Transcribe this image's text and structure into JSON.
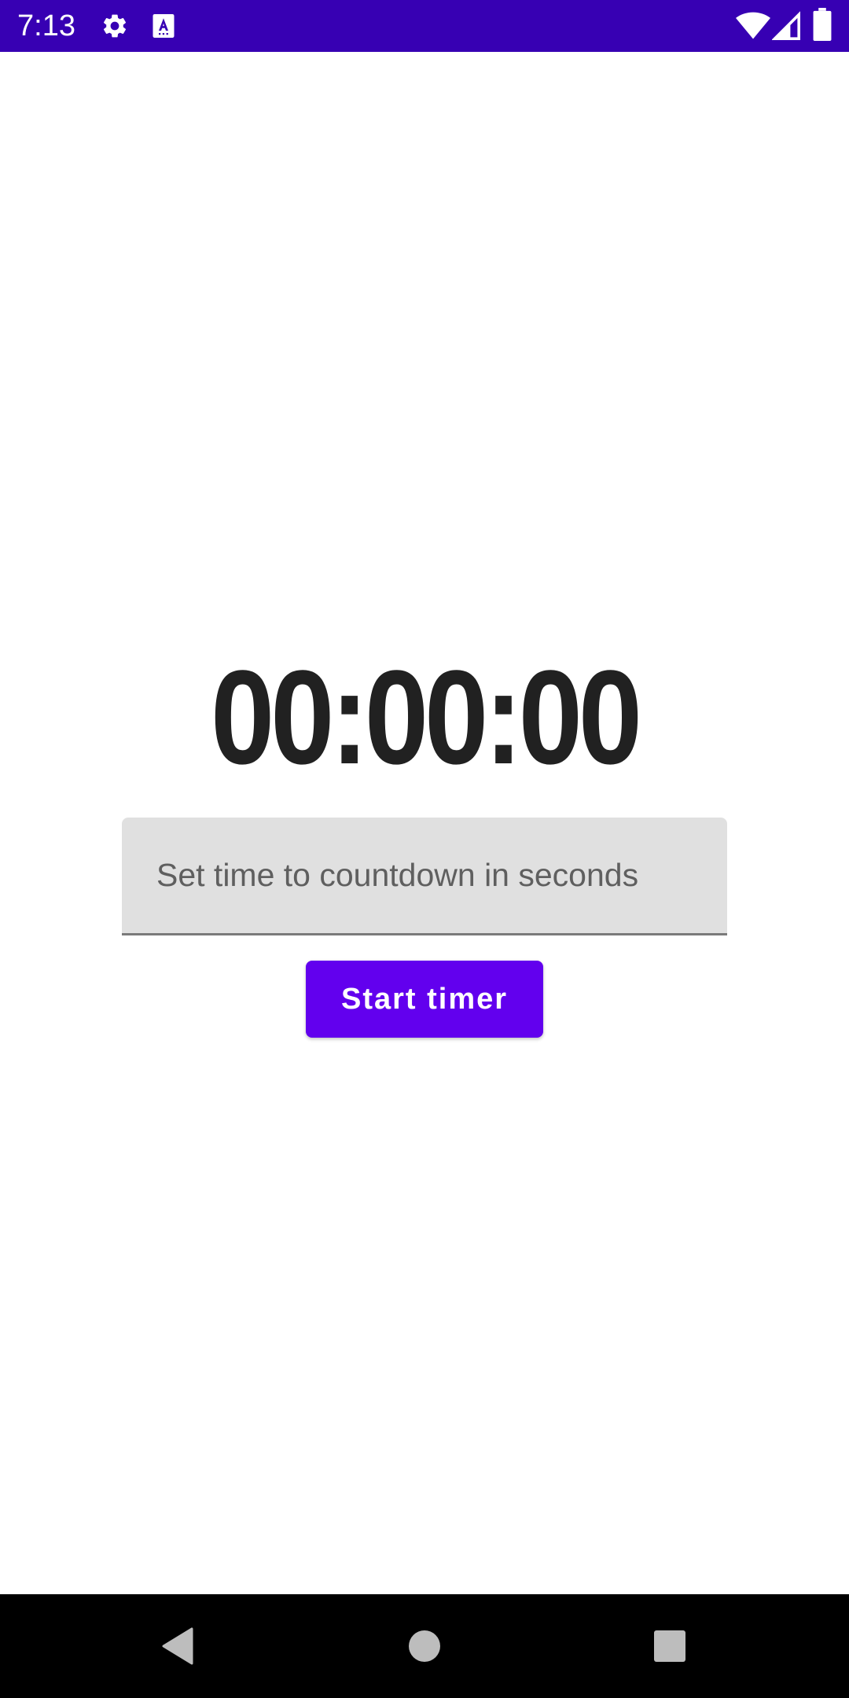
{
  "status_bar": {
    "time": "7:13",
    "icons": [
      "gear-icon",
      "a-text-icon",
      "wifi-icon",
      "signal-icon",
      "battery-icon"
    ],
    "background": "#3700b3"
  },
  "timer": {
    "display": "00:00:00"
  },
  "countdown_input": {
    "value": "",
    "placeholder": "Set time to countdown in seconds"
  },
  "start_button": {
    "label": "Start timer",
    "color": "#6200ee"
  },
  "nav_bar": {
    "buttons": [
      "back-icon",
      "home-icon",
      "recents-icon"
    ]
  }
}
